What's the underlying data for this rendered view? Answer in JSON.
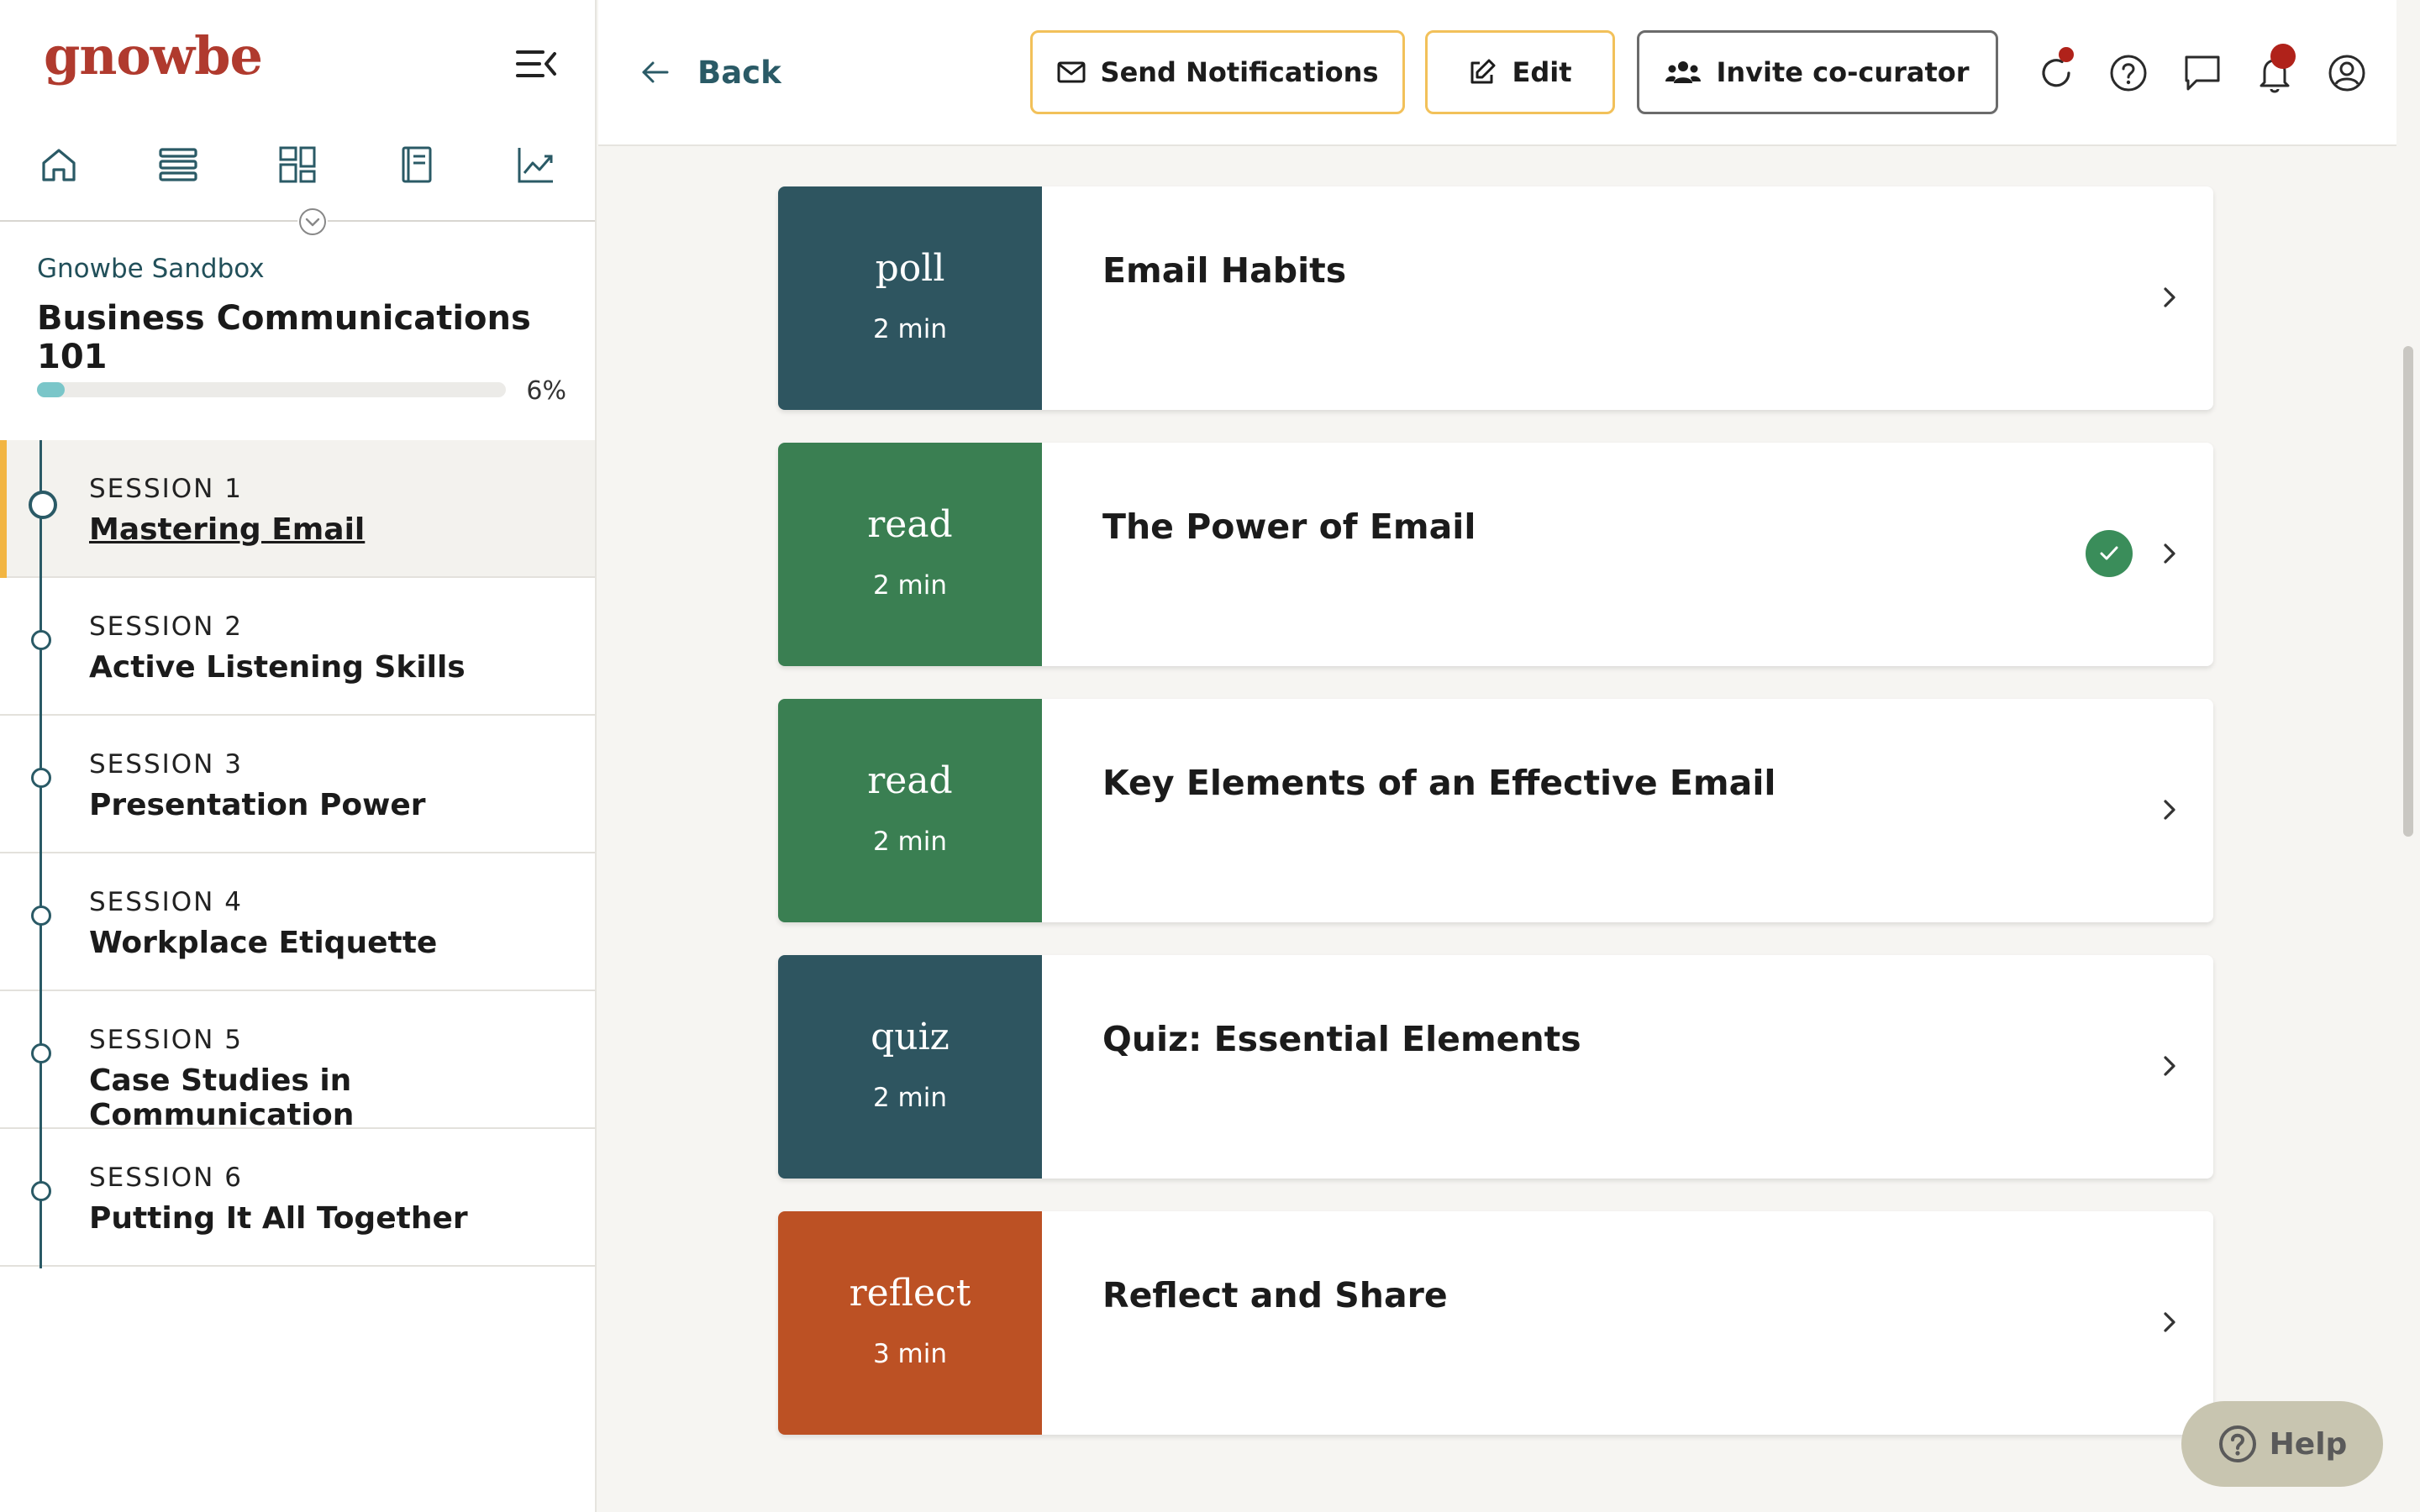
{
  "brand": {
    "logo_text": "gnowbe"
  },
  "nav": {
    "icons": [
      "home-icon",
      "list-icon",
      "dashboard-icon",
      "book-icon",
      "analytics-icon"
    ]
  },
  "course": {
    "org": "Gnowbe Sandbox",
    "title": "Business Communications 101",
    "progress_label": "6%",
    "progress_fraction": 0.06
  },
  "sessions": [
    {
      "number": "SESSION 1",
      "title": "Mastering Email",
      "active": true
    },
    {
      "number": "SESSION 2",
      "title": "Active Listening Skills",
      "active": false
    },
    {
      "number": "SESSION 3",
      "title": "Presentation Power",
      "active": false
    },
    {
      "number": "SESSION 4",
      "title": "Workplace Etiquette",
      "active": false
    },
    {
      "number": "SESSION 5",
      "title": "Case Studies in Communication",
      "active": false
    },
    {
      "number": "SESSION 6",
      "title": "Putting It All Together",
      "active": false
    }
  ],
  "topbar": {
    "back_label": "Back",
    "send_notifications_label": "Send Notifications",
    "edit_label": "Edit",
    "invite_label": "Invite co-curator"
  },
  "cards": [
    {
      "type": "poll",
      "duration": "2 min",
      "title": "Email Habits",
      "color": "#2e5560",
      "completed": false
    },
    {
      "type": "read",
      "duration": "2 min",
      "title": "The Power of Email",
      "color": "#3a7f52",
      "completed": true
    },
    {
      "type": "read",
      "duration": "2 min",
      "title": "Key Elements of an Effective Email",
      "color": "#3a7f52",
      "completed": false
    },
    {
      "type": "quiz",
      "duration": "2 min",
      "title": "Quiz: Essential Elements",
      "color": "#2e5560",
      "completed": false
    },
    {
      "type": "reflect",
      "duration": "3 min",
      "title": "Reflect and Share",
      "color": "#bc5124",
      "completed": false
    }
  ],
  "help": {
    "label": "Help"
  },
  "colors": {
    "brand": "#b03a2e",
    "accent_yellow": "#f2b542",
    "teal": "#2a5a66",
    "badge_red": "#b0221a",
    "check_green": "#3a8d5a"
  }
}
